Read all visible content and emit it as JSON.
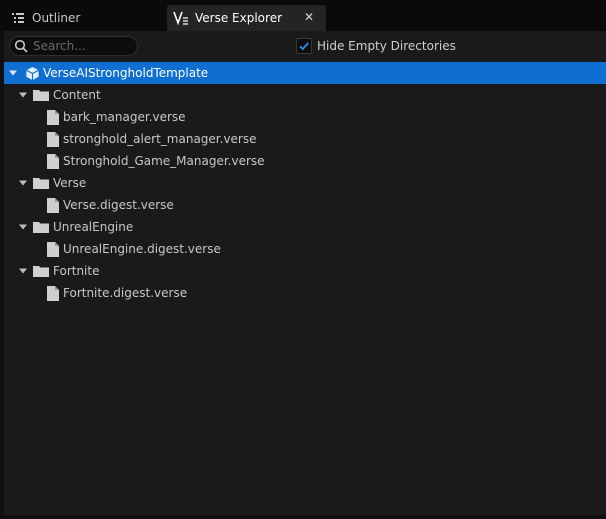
{
  "tabs": [
    {
      "label": "Outliner",
      "icon": "outliner-icon"
    },
    {
      "label": "Verse Explorer",
      "icon": "verse-icon"
    }
  ],
  "toolbar": {
    "search_placeholder": "Search...",
    "hide_empty_label": "Hide Empty Directories",
    "hide_empty_checked": true
  },
  "tree": {
    "project": "VerseAIStrongholdTemplate",
    "folders": [
      {
        "name": "Content",
        "files": [
          "bark_manager.verse",
          "stronghold_alert_manager.verse",
          "Stronghold_Game_Manager.verse"
        ]
      },
      {
        "name": "Verse",
        "files": [
          "Verse.digest.verse"
        ]
      },
      {
        "name": "UnrealEngine",
        "files": [
          "UnrealEngine.digest.verse"
        ]
      },
      {
        "name": "Fortnite",
        "files": [
          "Fortnite.digest.verse"
        ]
      }
    ]
  },
  "colors": {
    "selection": "#0e6fd1",
    "panel_bg": "#1a1a1a",
    "tab_active_bg": "#242424",
    "check_accent": "#2f8cf0"
  }
}
